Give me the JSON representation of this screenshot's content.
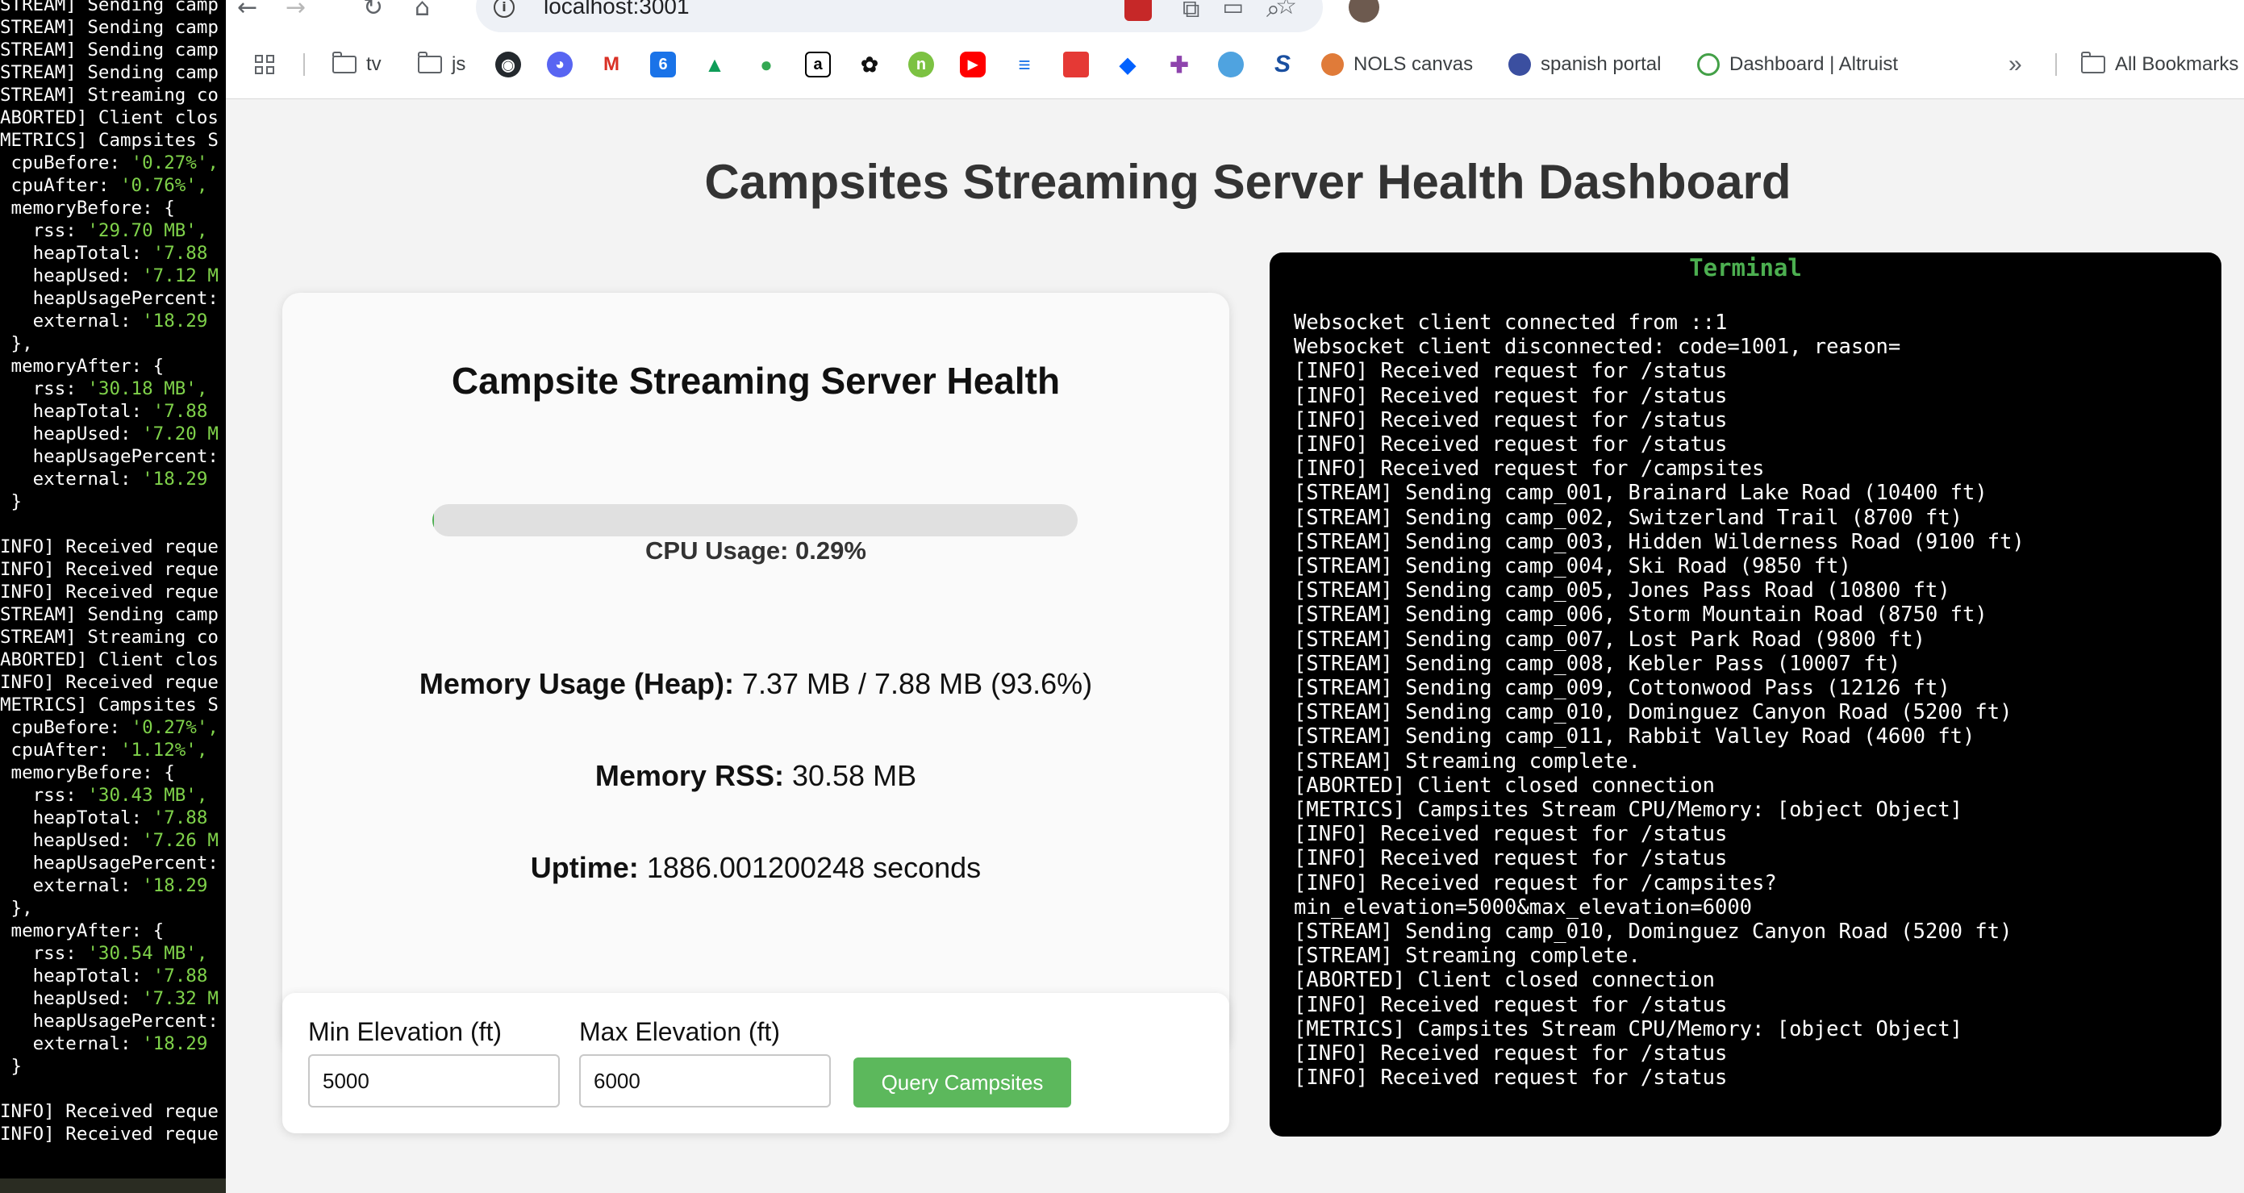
{
  "left_terminal": {
    "lines": [
      "STREAM] Sending camp",
      "STREAM] Sending camp",
      "STREAM] Sending camp",
      "STREAM] Sending camp",
      "STREAM] Streaming co",
      "ABORTED] Client clos",
      "METRICS] Campsites S",
      " cpuBefore: '0.27%',",
      " cpuAfter: '0.76%',",
      " memoryBefore: {",
      "   rss: '29.70 MB',",
      "   heapTotal: '7.88",
      "   heapUsed: '7.12 M",
      "   heapUsagePercent:",
      "   external: '18.29",
      " },",
      " memoryAfter: {",
      "   rss: '30.18 MB',",
      "   heapTotal: '7.88",
      "   heapUsed: '7.20 M",
      "   heapUsagePercent:",
      "   external: '18.29",
      " }",
      "",
      "INFO] Received reque",
      "INFO] Received reque",
      "INFO] Received reque",
      "STREAM] Sending camp",
      "STREAM] Streaming co",
      "ABORTED] Client clos",
      "INFO] Received reque",
      "METRICS] Campsites S",
      " cpuBefore: '0.27%',",
      " cpuAfter: '1.12%',",
      " memoryBefore: {",
      "   rss: '30.43 MB',",
      "   heapTotal: '7.88",
      "   heapUsed: '7.26 M",
      "   heapUsagePercent:",
      "   external: '18.29",
      " },",
      " memoryAfter: {",
      "   rss: '30.54 MB',",
      "   heapTotal: '7.88",
      "   heapUsed: '7.32 M",
      "   heapUsagePercent:",
      "   external: '18.29",
      " }",
      "",
      "INFO] Received reque",
      "INFO] Received reque"
    ]
  },
  "browser": {
    "url": "localhost:3001",
    "bookmarks": {
      "tv": "tv",
      "js": "js",
      "nols": "NOLS canvas",
      "spanish": "spanish portal",
      "altruist": "Dashboard | Altruist",
      "all": "All Bookmarks"
    }
  },
  "page": {
    "title": "Campsites Streaming Server Health Dashboard"
  },
  "health": {
    "title": "Campsite Streaming Server Health",
    "cpu_label": "CPU Usage: 0.29%",
    "cpu_percent": 0.29,
    "memory_heap_label": "Memory Usage (Heap):",
    "memory_heap_value": "7.37 MB / 7.88 MB (93.6%)",
    "memory_rss_label": "Memory RSS:",
    "memory_rss_value": "30.58 MB",
    "uptime_label": "Uptime:",
    "uptime_value": "1886.001200248 seconds"
  },
  "query": {
    "min_label": "Min Elevation (ft)",
    "min_value": "5000",
    "max_label": "Max Elevation (ft)",
    "max_value": "6000",
    "button": "Query Campsites"
  },
  "terminal": {
    "title": "Terminal",
    "lines": [
      "Websocket client connected from ::1",
      "Websocket client disconnected: code=1001, reason=",
      "[INFO] Received request for /status",
      "[INFO] Received request for /status",
      "[INFO] Received request for /status",
      "[INFO] Received request for /status",
      "[INFO] Received request for /campsites",
      "[STREAM] Sending camp_001, Brainard Lake Road (10400 ft)",
      "[STREAM] Sending camp_002, Switzerland Trail (8700 ft)",
      "[STREAM] Sending camp_003, Hidden Wilderness Road (9100 ft)",
      "[STREAM] Sending camp_004, Ski Road (9850 ft)",
      "[STREAM] Sending camp_005, Jones Pass Road (10800 ft)",
      "[STREAM] Sending camp_006, Storm Mountain Road (8750 ft)",
      "[STREAM] Sending camp_007, Lost Park Road (9800 ft)",
      "[STREAM] Sending camp_008, Kebler Pass (10007 ft)",
      "[STREAM] Sending camp_009, Cottonwood Pass (12126 ft)",
      "[STREAM] Sending camp_010, Dominguez Canyon Road (5200 ft)",
      "[STREAM] Sending camp_011, Rabbit Valley Road (4600 ft)",
      "[STREAM] Streaming complete.",
      "[ABORTED] Client closed connection",
      "[METRICS] Campsites Stream CPU/Memory: [object Object]",
      "[INFO] Received request for /status",
      "[INFO] Received request for /status",
      "[INFO] Received request for /campsites?",
      "min_elevation=5000&max_elevation=6000",
      "[STREAM] Sending camp_010, Dominguez Canyon Road (5200 ft)",
      "[STREAM] Streaming complete.",
      "[ABORTED] Client closed connection",
      "[INFO] Received request for /status",
      "[METRICS] Campsites Stream CPU/Memory: [object Object]",
      "[INFO] Received request for /status",
      "[INFO] Received request for /status"
    ]
  },
  "colors": {
    "accent_green": "#4caf50",
    "button_green": "#5cb85c",
    "terminal_bg": "#000000"
  }
}
